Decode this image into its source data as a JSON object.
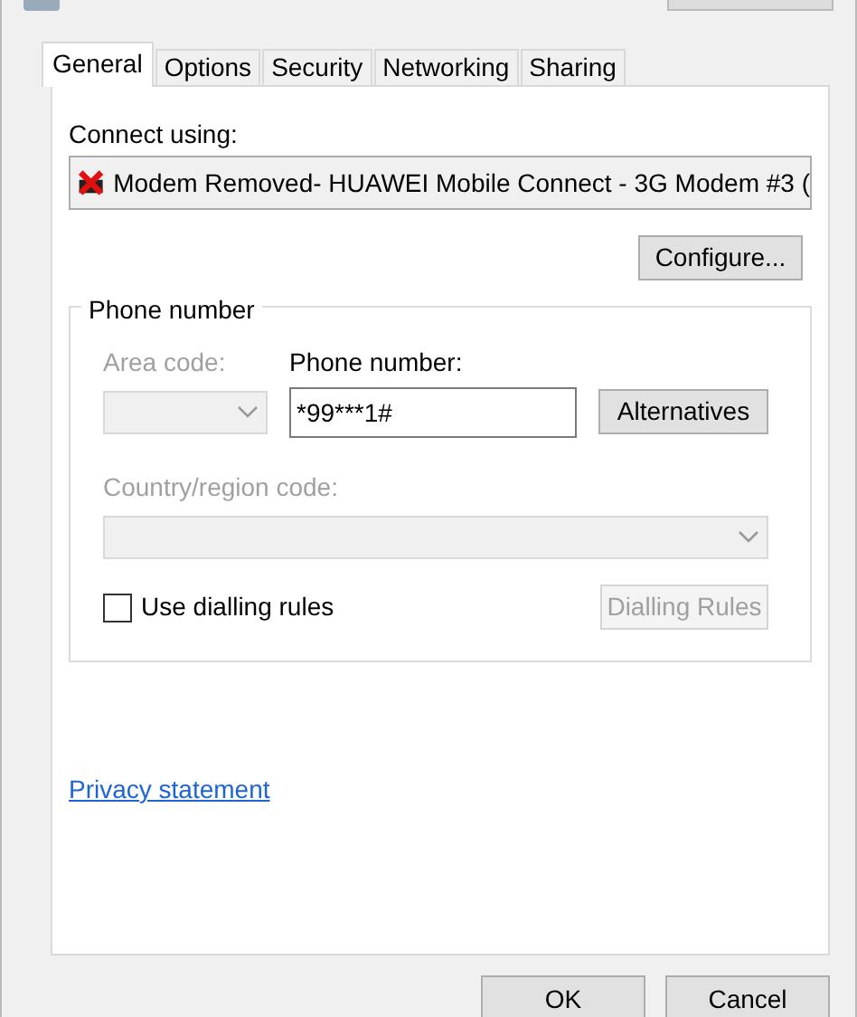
{
  "tabs": [
    {
      "label": "General",
      "selected": true
    },
    {
      "label": "Options",
      "selected": false
    },
    {
      "label": "Security",
      "selected": false
    },
    {
      "label": "Networking",
      "selected": false
    },
    {
      "label": "Sharing",
      "selected": false
    }
  ],
  "connect_using": {
    "label": "Connect using:",
    "device": "Modem Removed- HUAWEI Mobile Connect - 3G Modem #3 ("
  },
  "configure_button": "Configure...",
  "phone_group": {
    "title": "Phone number",
    "area_code": {
      "label": "Area code:",
      "disabled": true
    },
    "phone_number": {
      "label": "Phone number:",
      "value": "*99***1#",
      "disabled": false
    },
    "alternatives_button": {
      "label": "Alternatives",
      "disabled": false
    },
    "country_code": {
      "label": "Country/region code:",
      "disabled": true
    },
    "use_dialling_rules": {
      "label": "Use dialling rules",
      "checked": false
    },
    "dialling_rules_button": {
      "label": "Dialling Rules",
      "disabled": true
    }
  },
  "privacy_link": "Privacy statement",
  "buttons": [
    "OK",
    "Cancel"
  ]
}
